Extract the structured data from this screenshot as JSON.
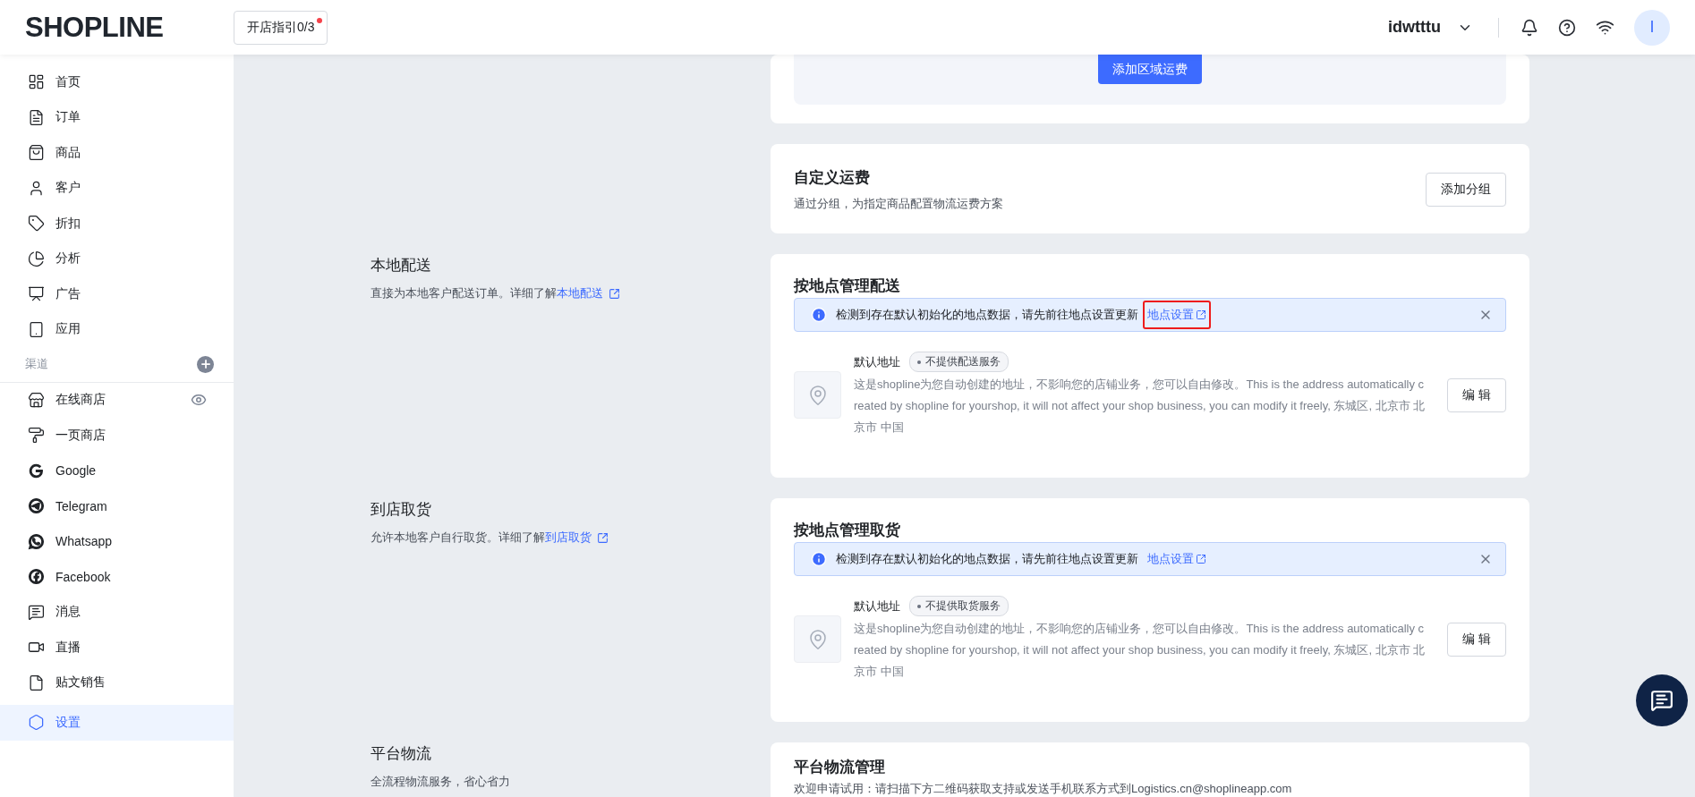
{
  "header": {
    "logo": "SHOPLINE",
    "guide_button": {
      "label": "开店指引0/3",
      "has_notice": true
    },
    "store_name": "idwtttu",
    "avatar": "I"
  },
  "sidebar": {
    "items": [
      {
        "label": "首页",
        "selected": false
      },
      {
        "label": "订单",
        "selected": false
      },
      {
        "label": "商品",
        "selected": false
      },
      {
        "label": "客户",
        "selected": false
      },
      {
        "label": "折扣",
        "selected": false
      },
      {
        "label": "分析",
        "selected": false
      },
      {
        "label": "广告",
        "selected": false
      },
      {
        "label": "应用",
        "selected": false
      }
    ],
    "channels_heading": "渠道",
    "channels": [
      {
        "label": "在线商店",
        "selected": false,
        "has_preview": true
      },
      {
        "label": "一页商店",
        "selected": false,
        "has_preview": false
      },
      {
        "label": "Google",
        "selected": false,
        "has_preview": false
      },
      {
        "label": "Telegram",
        "selected": false,
        "has_preview": false
      },
      {
        "label": "Whatsapp",
        "selected": false,
        "has_preview": false
      },
      {
        "label": "Facebook",
        "selected": false,
        "has_preview": false
      },
      {
        "label": "消息",
        "selected": false,
        "has_preview": false
      },
      {
        "label": "直播",
        "selected": false,
        "has_preview": false
      },
      {
        "label": "贴文销售",
        "selected": false,
        "has_preview": false
      }
    ],
    "footer_items": [
      {
        "label": "设置",
        "selected": true
      }
    ]
  },
  "top_cards": [
    {
      "kind": "zone",
      "button": "添加区域运费"
    },
    {
      "kind": "custom",
      "title": "自定义运费",
      "description": "通过分组，为指定商品配置物流运费方案",
      "button": "添加分组"
    }
  ],
  "sections": [
    {
      "title": "本地配送",
      "description": "直接为本地客户配送订单。详细了解",
      "link": "本地配送",
      "card": {
        "kind": "locations",
        "title": "按地点管理配送",
        "alert": {
          "text": "检测到存在默认初始化的地点数据，请先前往地点设置更新",
          "link": "地点设置",
          "highlighted": true
        },
        "address": {
          "name": "默认地址",
          "tag": "不提供配送服务",
          "text": "这是shopline为您自动创建的地址，不影响您的店铺业务，您可以自由修改。This is the address automatically created by shopline for yourshop, it will not affect your shop business, you can modify it freely, 东城区, 北京市 北京市 中国",
          "button": "编 辑"
        }
      }
    },
    {
      "title": "到店取货",
      "description": "允许本地客户自行取货。详细了解",
      "link": "到店取货",
      "card": {
        "kind": "locations",
        "title": "按地点管理取货",
        "alert": {
          "text": "检测到存在默认初始化的地点数据，请先前往地点设置更新",
          "link": "地点设置",
          "highlighted": false
        },
        "address": {
          "name": "默认地址",
          "tag": "不提供取货服务",
          "text": "这是shopline为您自动创建的地址，不影响您的店铺业务，您可以自由修改。This is the address automatically created by shopline for yourshop, it will not affect your shop business, you can modify it freely, 东城区, 北京市 北京市 中国",
          "button": "编 辑"
        }
      }
    },
    {
      "title": "平台物流",
      "description": "全流程物流服务，省心省力",
      "card": {
        "kind": "platform",
        "title": "平台物流管理",
        "text": "欢迎申请试用：请扫描下方二维码获取支持或发送手机联系方式到Logistics.cn@shoplineapp.com"
      }
    }
  ]
}
